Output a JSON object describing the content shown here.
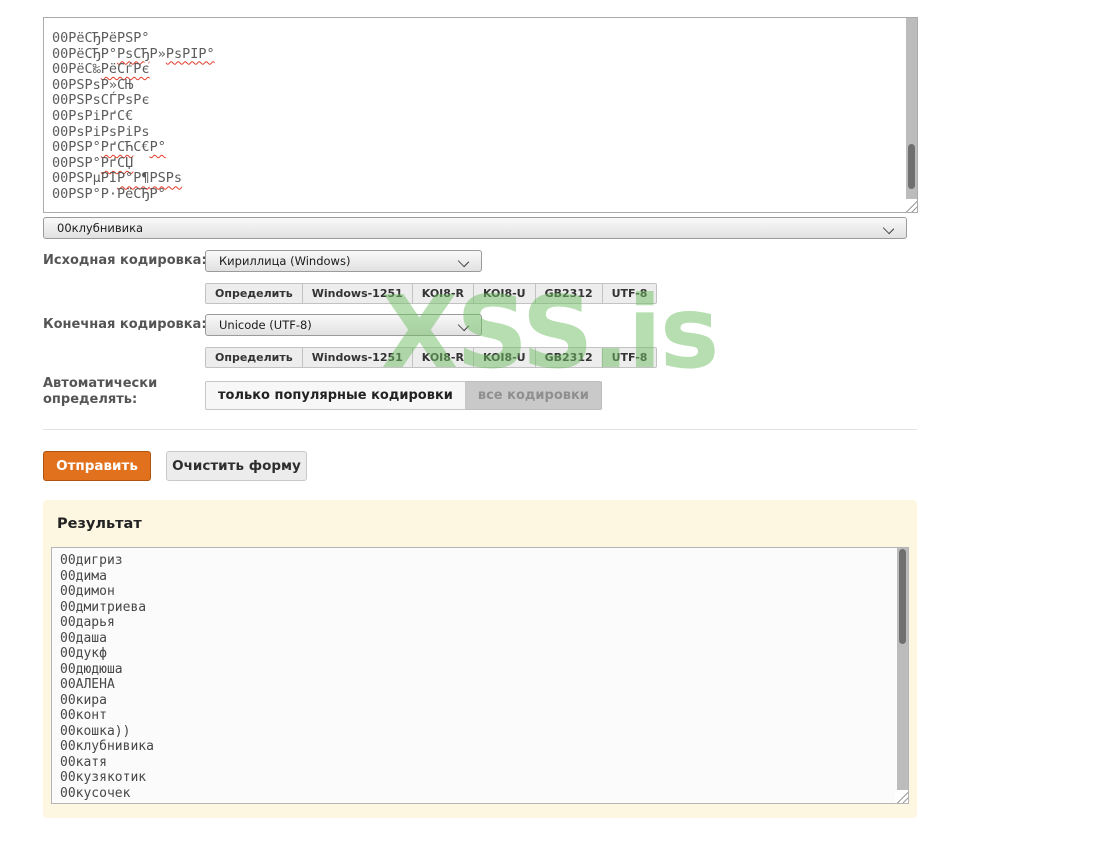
{
  "watermark": "XSS.is",
  "colors": {
    "accent_orange": "#e2711e",
    "watermark_green": "#6fbf63",
    "result_panel_bg": "#fdf7e2"
  },
  "source_textarea": {
    "lines": [
      {
        "segments": [
          {
            "text": "00РёСЂРёРЅР°",
            "misspelled": false
          }
        ]
      },
      {
        "segments": [
          {
            "text": "00РёСЂР°",
            "misspelled": false
          },
          {
            "text": "РѕСЂ",
            "misspelled": true
          },
          {
            "text": "Р»",
            "misspelled": false
          },
          {
            "text": "РѕРІР°",
            "misspelled": true
          }
        ]
      },
      {
        "segments": [
          {
            "text": "00РёС‰",
            "misspelled": false
          },
          {
            "text": "РёСѓРє",
            "misspelled": true
          }
        ]
      },
      {
        "segments": [
          {
            "text": "00РЅРѕР»СЊ",
            "misspelled": false
          }
        ]
      },
      {
        "segments": [
          {
            "text": "00РЅРѕСЃРѕРє",
            "misspelled": false
          }
        ]
      },
      {
        "segments": [
          {
            "text": "00РѕРіРґС€",
            "misspelled": false
          }
        ]
      },
      {
        "segments": [
          {
            "text": "00РѕРіРѕРіРѕ",
            "misspelled": false
          }
        ]
      },
      {
        "segments": [
          {
            "text": "00РЅР°",
            "misspelled": false
          },
          {
            "text": "РґСЋ",
            "misspelled": true
          },
          {
            "text": "С€",
            "misspelled": false
          },
          {
            "text": "Р°",
            "misspelled": true
          }
        ]
      },
      {
        "segments": [
          {
            "text": "00РЅР°",
            "misspelled": false
          },
          {
            "text": "РґСЏ",
            "misspelled": true
          }
        ]
      },
      {
        "segments": [
          {
            "text": "00РЅРµРІ",
            "misspelled": false
          },
          {
            "text": "Р°Р¶",
            "misspelled": true
          },
          {
            "text": "РЅРѕ",
            "misspelled": true
          }
        ]
      },
      {
        "segments": [
          {
            "text": "00РЅР°Р·РёСЂР°",
            "misspelled": false
          }
        ]
      }
    ]
  },
  "name_select": {
    "value": "00клубнивика"
  },
  "source_encoding": {
    "label": "Исходная кодировка:",
    "select_value": "Кириллица (Windows)"
  },
  "target_encoding": {
    "label": "Конечная кодировка:",
    "select_value": "Unicode (UTF-8)"
  },
  "encoding_buttons": [
    "Определить",
    "Windows-1251",
    "KOI8-R",
    "KOI8-U",
    "GB2312",
    "UTF-8"
  ],
  "auto_detect": {
    "label_line1": "Автоматически",
    "label_line2": "определять:",
    "popular_button": "только популярные кодировки",
    "all_button": "все кодировки"
  },
  "actions": {
    "submit": "Отправить",
    "clear": "Очистить форму"
  },
  "result": {
    "title": "Результат",
    "lines": [
      "00дигриз",
      "00дима",
      "00димон",
      "00дмитриева",
      "00дарья",
      "00даша",
      "00дукф",
      "00дюдюша",
      "00АЛЕНА",
      "00кира",
      "00конт",
      "00кошка))",
      "00клубнивика",
      "00катя",
      "00кузякотик",
      "00кусочек"
    ]
  }
}
